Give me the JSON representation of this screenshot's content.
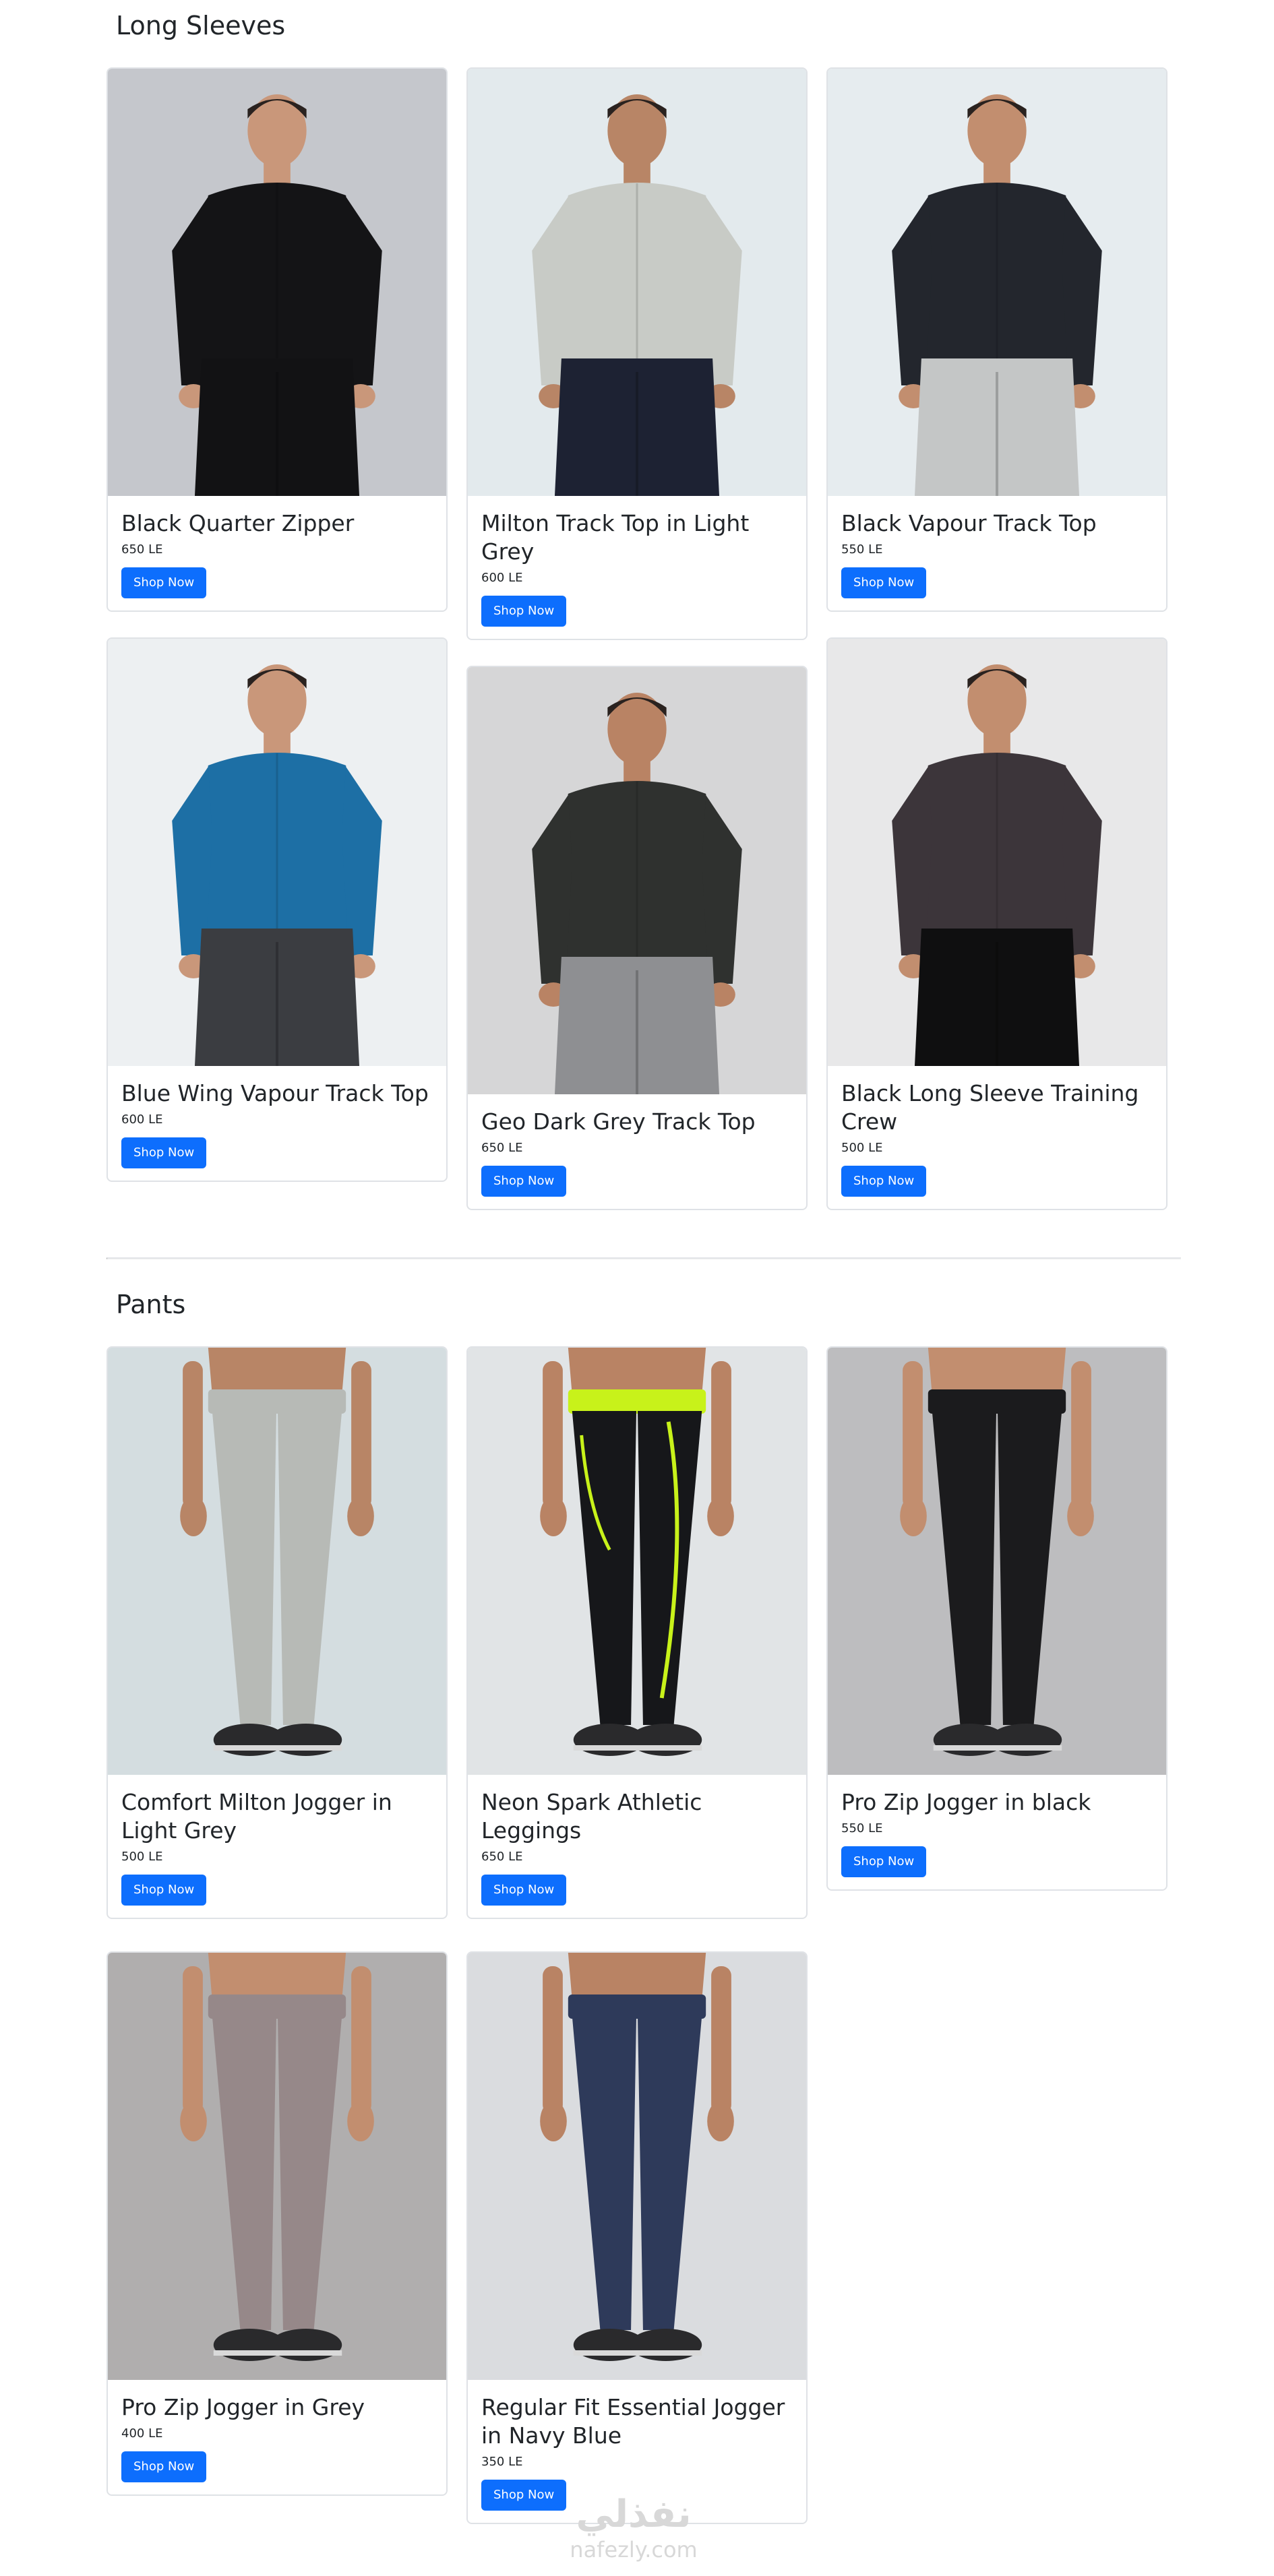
{
  "sections": [
    {
      "title": "Long Sleeves",
      "products": [
        {
          "name": "Black Quarter Zipper",
          "price": "650 LE",
          "button": "Shop Now",
          "bg": "#c5c7cc",
          "garment": "#141416",
          "pants": "#121214",
          "skin": "#c9977a"
        },
        {
          "name": "Milton Track Top in Light Grey",
          "price": "600 LE",
          "button": "Shop Now",
          "bg": "#e3eaed",
          "garment": "#c8cbc6",
          "pants": "#1d2233",
          "skin": "#b88566"
        },
        {
          "name": "Black Vapour Track Top",
          "price": "550 LE",
          "button": "Shop Now",
          "bg": "#e6ecef",
          "garment": "#23262d",
          "pants": "#c4c6c6",
          "skin": "#c28e6f"
        },
        {
          "name": "Blue Wing Vapour Track Top",
          "price": "600 LE",
          "button": "Shop Now",
          "bg": "#edf0f2",
          "garment": "#1d6fa5",
          "pants": "#3b3d41",
          "skin": "#c9977a"
        },
        {
          "name": "Geo Dark Grey Track Top",
          "price": "650 LE",
          "button": "Shop Now",
          "bg": "#d6d6d7",
          "garment": "#2f312f",
          "pants": "#8e8f92",
          "skin": "#b98364"
        },
        {
          "name": "Black Long Sleeve Training Crew",
          "price": "500 LE",
          "button": "Shop Now",
          "bg": "#e8e8e9",
          "garment": "#3c353a",
          "pants": "#0f0f10",
          "skin": "#c28e6f"
        }
      ]
    },
    {
      "title": "Pants",
      "products": [
        {
          "name": "Comfort Milton Jogger in Light Grey",
          "price": "500 LE",
          "button": "Shop Now",
          "bg": "#d4dde0",
          "garment": "#b7bab6",
          "pants": "#b7bab6",
          "skin": "#b88566"
        },
        {
          "name": "Neon Spark Athletic Leggings",
          "price": "650 LE",
          "button": "Shop Now",
          "bg": "#e1e4e6",
          "garment": "#16171a",
          "pants": "#16171a",
          "skin": "#b98364",
          "accent": "#c8f21a"
        },
        {
          "name": "Pro Zip Jogger in black",
          "price": "550 LE",
          "button": "Shop Now",
          "bg": "#bdbdbf",
          "garment": "#1b1b1d",
          "pants": "#1b1b1d",
          "skin": "#c28e6f"
        },
        {
          "name": "Pro Zip Jogger in Grey",
          "price": "400 LE",
          "button": "Shop Now",
          "bg": "#b0aeae",
          "garment": "#968889",
          "pants": "#968889",
          "skin": "#c28e6f"
        },
        {
          "name": "Regular Fit Essential Jogger in Navy Blue",
          "price": "350 LE",
          "button": "Shop Now",
          "bg": "#dadcdf",
          "garment": "#2e3a5a",
          "pants": "#2e3a5a",
          "skin": "#b98364"
        }
      ]
    }
  ],
  "watermark": {
    "arabic": "نفذلي",
    "latin": "nafezly.com"
  },
  "colors": {
    "primary": "#0d6efd",
    "border": "#dfe2e6"
  }
}
